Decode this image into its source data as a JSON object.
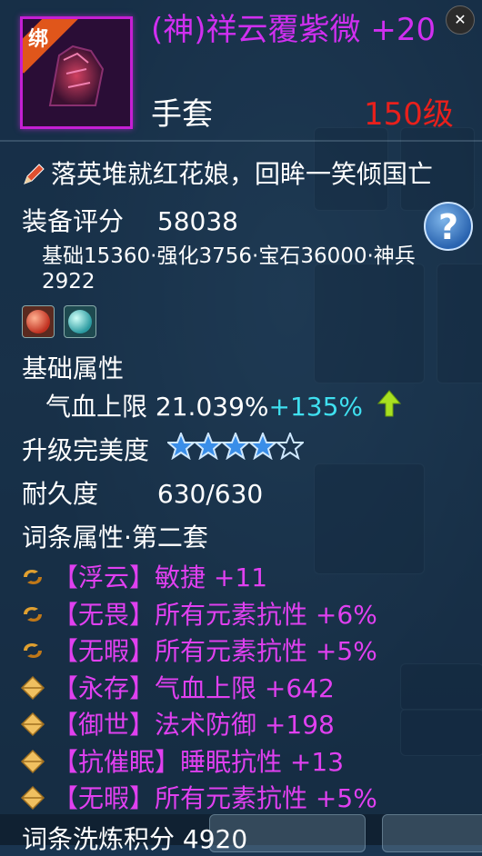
{
  "item": {
    "bind_badge": "绑",
    "title": "(神)祥云覆紫微 +20",
    "type": "手套",
    "level": "150级",
    "quote": "落英堆就红花娘，回眸一笑倾国亡"
  },
  "score": {
    "label": "装备评分",
    "value": "58038",
    "breakdown": "基础15360·强化3756·宝石36000·神兵2922"
  },
  "base_attr": {
    "section": "基础属性",
    "name": "气血上限",
    "value": "21.039%",
    "bonus": "+135%"
  },
  "upgrade": {
    "label": "升级完美度",
    "stars_filled": 4,
    "stars_total": 5
  },
  "durability": {
    "label": "耐久度",
    "value": "630/630"
  },
  "affix_section": "词条属性·第二套",
  "affixes": [
    {
      "icon": "swirl-icon",
      "tag": "【浮云】",
      "text": "敏捷 +11"
    },
    {
      "icon": "swirl-icon",
      "tag": "【无畏】",
      "text": "所有元素抗性 +6%"
    },
    {
      "icon": "swirl-icon",
      "tag": "【无暇】",
      "text": "所有元素抗性 +5%"
    },
    {
      "icon": "diamond-icon",
      "tag": "【永存】",
      "text": "气血上限 +642"
    },
    {
      "icon": "diamond-icon",
      "tag": "【御世】",
      "text": "法术防御 +198"
    },
    {
      "icon": "diamond-icon",
      "tag": "【抗催眠】",
      "text": "睡眠抗性 +13"
    },
    {
      "icon": "diamond-icon",
      "tag": "【无暇】",
      "text": "所有元素抗性 +5%"
    }
  ],
  "refine": {
    "label": "词条洗炼积分",
    "value": "4920"
  },
  "colors": {
    "title_purple": "#d02ff0",
    "level_red": "#e8201c",
    "bonus_cyan": "#3fe0f0",
    "affix_purple": "#e040f0"
  }
}
